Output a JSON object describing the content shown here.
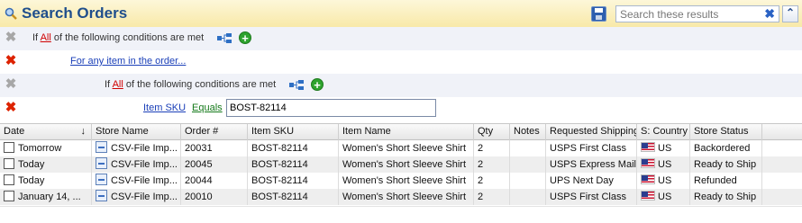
{
  "header": {
    "title": "Search Orders",
    "search_placeholder": "Search these results",
    "search_value": "",
    "clear_glyph": "✖",
    "collapse_glyph": "⌃"
  },
  "conditions": {
    "rows": [
      {
        "prefix": "If",
        "all_label": "All",
        "suffix": "of the following conditions are met"
      },
      {
        "link": "For any item in the order..."
      },
      {
        "prefix": "If",
        "all_label": "All",
        "suffix": "of the following conditions are met"
      },
      {
        "field": "Item SKU",
        "operator": "Equals",
        "value": "BOST-82114"
      }
    ]
  },
  "grid": {
    "columns": [
      "Date",
      "Store Name",
      "Order #",
      "Item SKU",
      "Item Name",
      "Qty",
      "Notes",
      "Requested Shipping",
      "S: Country",
      "Store Status"
    ],
    "sort_indicator": "↓",
    "rows": [
      {
        "date": "Tomorrow",
        "store": "CSV-File Imp...",
        "order": "20031",
        "sku": "BOST-82114",
        "item": "Women's Short Sleeve Shirt",
        "qty": "2",
        "notes": "",
        "shipping": "USPS First Class",
        "country": "US",
        "status": "Backordered"
      },
      {
        "date": "Today",
        "store": "CSV-File Imp...",
        "order": "20045",
        "sku": "BOST-82114",
        "item": "Women's Short Sleeve Shirt",
        "qty": "2",
        "notes": "",
        "shipping": "USPS Express Mail",
        "country": "US",
        "status": "Ready to Ship"
      },
      {
        "date": "Today",
        "store": "CSV-File Imp...",
        "order": "20044",
        "sku": "BOST-82114",
        "item": "Women's Short Sleeve Shirt",
        "qty": "2",
        "notes": "",
        "shipping": "UPS Next Day",
        "country": "US",
        "status": "Refunded"
      },
      {
        "date": "January 14, ...",
        "store": "CSV-File Imp...",
        "order": "20010",
        "sku": "BOST-82114",
        "item": "Women's Short Sleeve Shirt",
        "qty": "2",
        "notes": "",
        "shipping": "USPS First Class",
        "country": "US",
        "status": "Ready to Ship"
      }
    ]
  },
  "colors": {
    "title": "#1f4e8c",
    "remove_active": "#dd2200",
    "remove_inactive": "#a7a7a7",
    "all_link": "#d00000",
    "field_link": "#1a3fb8",
    "operator_link": "#157a1a"
  }
}
